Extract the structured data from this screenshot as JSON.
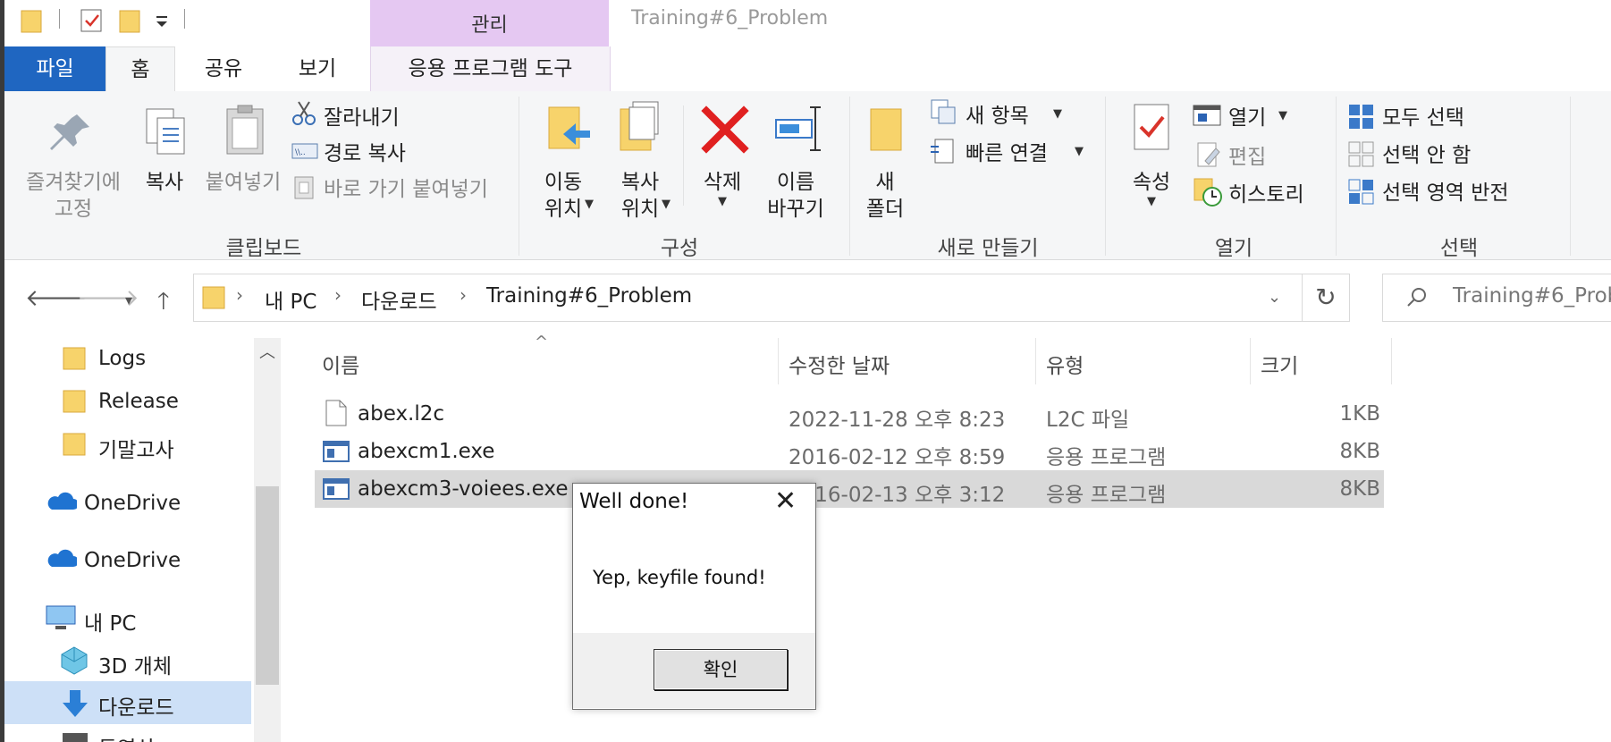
{
  "titlebar": {
    "manage_tab": "관리",
    "window_title": "Training#6_Problem"
  },
  "tabs": {
    "file": "파일",
    "home": "홈",
    "share": "공유",
    "view": "보기",
    "app_tools": "응용 프로그램 도구"
  },
  "ribbon": {
    "clipboard": {
      "pin_line1": "즐겨찾기에",
      "pin_line2": "고정",
      "copy": "복사",
      "paste": "붙여넣기",
      "cut": "잘라내기",
      "copy_path": "경로 복사",
      "paste_shortcut": "바로 가기 붙여넣기",
      "group": "클립보드"
    },
    "organize": {
      "move_line1": "이동",
      "move_line2": "위치",
      "copyto_line1": "복사",
      "copyto_line2": "위치",
      "delete": "삭제",
      "rename_line1": "이름",
      "rename_line2": "바꾸기",
      "group": "구성"
    },
    "new": {
      "folder_line1": "새",
      "folder_line2": "폴더",
      "new_item": "새 항목",
      "easy_access": "빠른 연결",
      "group": "새로 만들기"
    },
    "open": {
      "properties": "속성",
      "open": "열기",
      "edit": "편집",
      "history": "히스토리",
      "group": "열기"
    },
    "select": {
      "select_all": "모두 선택",
      "select_none": "선택 안 함",
      "invert": "선택 영역 반전",
      "group": "선택"
    }
  },
  "address": {
    "crumb1": "내 PC",
    "crumb2": "다운로드",
    "crumb3": "Training#6_Problem",
    "search_placeholder": "Training#6_Probl"
  },
  "navpane": {
    "items": [
      {
        "label": "Logs"
      },
      {
        "label": "Release"
      },
      {
        "label": "기말고사"
      },
      {
        "label": "OneDrive"
      },
      {
        "label": "OneDrive"
      },
      {
        "label": "내 PC"
      },
      {
        "label": "3D 개체"
      },
      {
        "label": "다운로드"
      },
      {
        "label": "동영상"
      }
    ]
  },
  "filelist": {
    "columns": {
      "name": "이름",
      "modified": "수정한 날짜",
      "type": "유형",
      "size": "크기"
    },
    "rows": [
      {
        "name": "abex.l2c",
        "modified": "2022-11-28 오후 8:23",
        "type": "L2C 파일",
        "size": "1KB"
      },
      {
        "name": "abexcm1.exe",
        "modified": "2016-02-12 오후 8:59",
        "type": "응용 프로그램",
        "size": "8KB"
      },
      {
        "name": "abexcm3-voiees.exe",
        "modified": "2016-02-13 오후 3:12",
        "type": "응용 프로그램",
        "size": "8KB"
      }
    ]
  },
  "dialog": {
    "title": "Well done!",
    "close": "✕",
    "message": "Yep, keyfile found!",
    "ok": "확인"
  },
  "colors": {
    "file_tab": "#1f66c1",
    "manage_tab": "#e5c8f2",
    "ribbon_bg": "#f5f6f7",
    "selection": "#d9d9d9",
    "nav_selection": "#cde0f7"
  }
}
